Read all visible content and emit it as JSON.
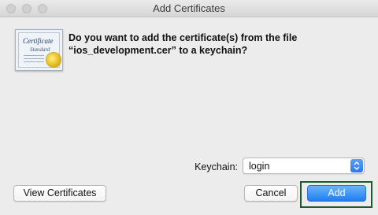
{
  "window": {
    "title": "Add Certificates"
  },
  "message": {
    "line1": "Do you want to add the certificate(s) from the file",
    "line2": "“ios_development.cer” to a keychain?"
  },
  "icon": {
    "name": "certificate-icon",
    "word": "Certificate",
    "sub": "Standard"
  },
  "keychain": {
    "label": "Keychain:",
    "value": "login"
  },
  "buttons": {
    "view_certificates": "View Certificates",
    "cancel": "Cancel",
    "add": "Add"
  },
  "colors": {
    "accent": "#1f7ef0",
    "focus_outline": "#1e5a2e",
    "background": "#ececec"
  }
}
